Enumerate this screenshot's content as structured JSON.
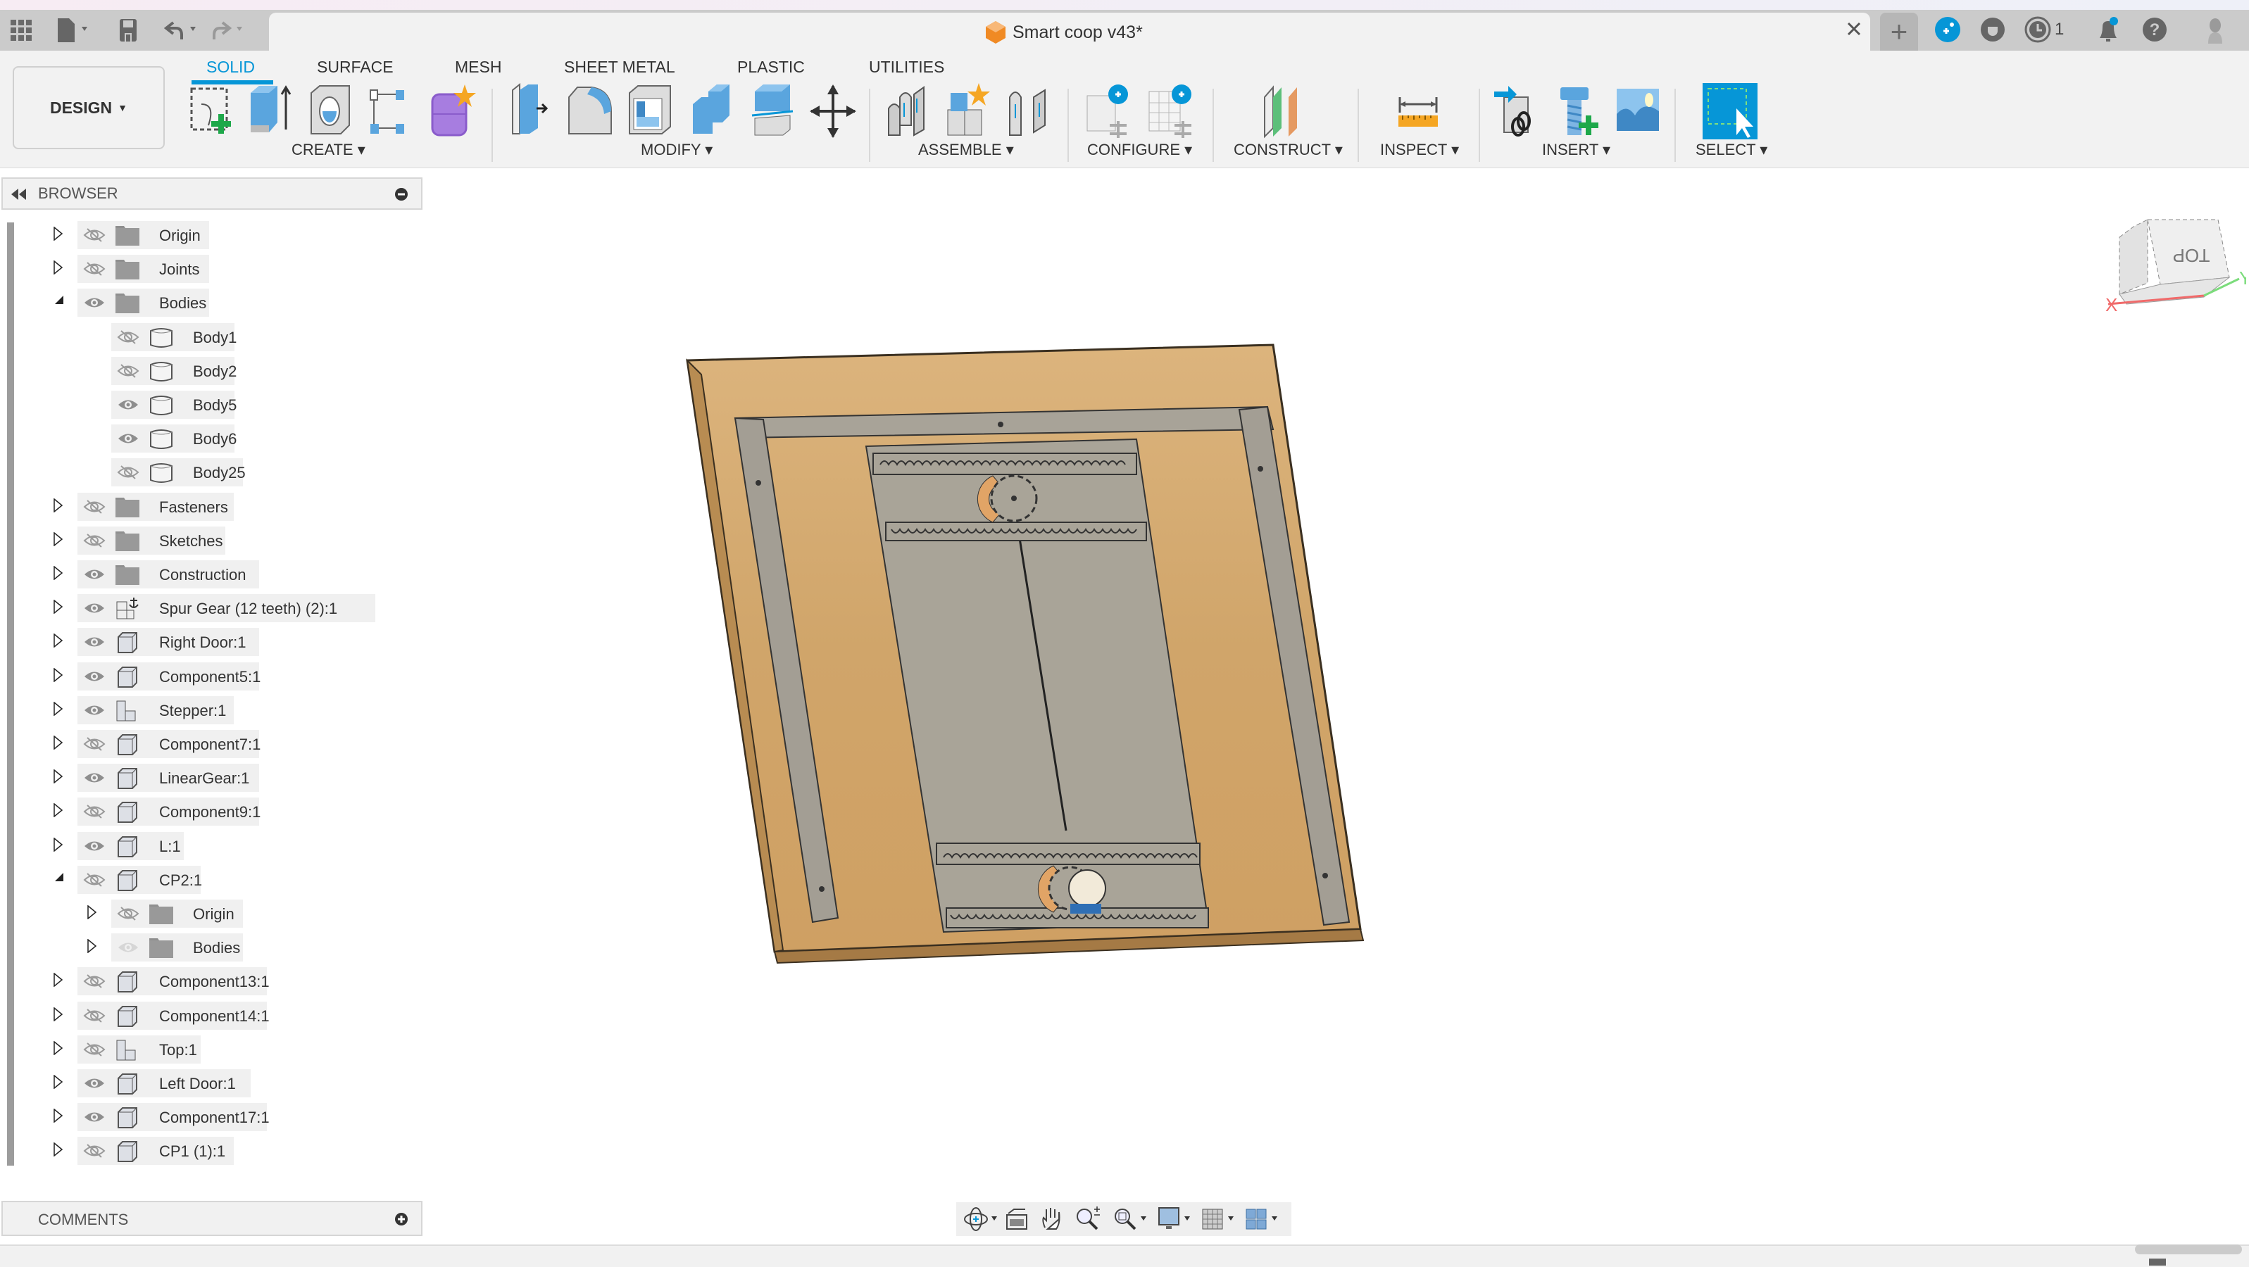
{
  "app": {
    "document_title": "Smart coop v43*",
    "quick_access": {
      "app_menu": "grid-icon",
      "file_menu": "file-icon",
      "save": "save-icon",
      "undo": "undo-icon",
      "redo": "redo-icon"
    },
    "header_right": {
      "new_tab": "+",
      "job_status_count": "1"
    }
  },
  "ribbon": {
    "workspace_button": "DESIGN",
    "tabs": [
      {
        "label": "SOLID",
        "active": true
      },
      {
        "label": "SURFACE",
        "active": false
      },
      {
        "label": "MESH",
        "active": false
      },
      {
        "label": "SHEET METAL",
        "active": false
      },
      {
        "label": "PLASTIC",
        "active": false
      },
      {
        "label": "UTILITIES",
        "active": false
      }
    ],
    "groups": [
      {
        "label": "CREATE",
        "tools": [
          "create-sketch",
          "extrude",
          "revolve",
          "pattern",
          "create-form"
        ]
      },
      {
        "label": "MODIFY",
        "tools": [
          "press-pull",
          "fillet",
          "shell",
          "combine",
          "split-body",
          "move-copy"
        ]
      },
      {
        "label": "ASSEMBLE",
        "tools": [
          "joint",
          "new-component",
          "as-built-joint"
        ]
      },
      {
        "label": "CONFIGURE",
        "tools": [
          "configure-design",
          "configuration-table"
        ]
      },
      {
        "label": "CONSTRUCT",
        "tools": [
          "offset-plane"
        ]
      },
      {
        "label": "INSPECT",
        "tools": [
          "measure"
        ]
      },
      {
        "label": "INSERT",
        "tools": [
          "insert-derive",
          "insert-mcmaster",
          "insert-canvas"
        ]
      },
      {
        "label": "SELECT",
        "tools": [
          "window-select"
        ]
      }
    ]
  },
  "browser": {
    "title": "BROWSER",
    "items": [
      {
        "label": "Origin",
        "level": 0,
        "expanded": false,
        "visible": false,
        "icon": "folder"
      },
      {
        "label": "Joints",
        "level": 0,
        "expanded": false,
        "visible": false,
        "icon": "folder"
      },
      {
        "label": "Bodies",
        "level": 0,
        "expanded": true,
        "visible": true,
        "icon": "folder"
      },
      {
        "label": "Body1",
        "level": 1,
        "leaf": true,
        "visible": false,
        "icon": "body"
      },
      {
        "label": "Body2",
        "level": 1,
        "leaf": true,
        "visible": false,
        "icon": "body"
      },
      {
        "label": "Body5",
        "level": 1,
        "leaf": true,
        "visible": true,
        "icon": "body"
      },
      {
        "label": "Body6",
        "level": 1,
        "leaf": true,
        "visible": true,
        "icon": "body"
      },
      {
        "label": "Body25",
        "level": 1,
        "leaf": true,
        "visible": false,
        "icon": "body"
      },
      {
        "label": "Fasteners",
        "level": 0,
        "expanded": false,
        "visible": false,
        "icon": "folder"
      },
      {
        "label": "Sketches",
        "level": 0,
        "expanded": false,
        "visible": false,
        "icon": "folder"
      },
      {
        "label": "Construction",
        "level": 0,
        "expanded": false,
        "visible": true,
        "icon": "folder"
      },
      {
        "label": "Spur Gear (12 teeth) (2):1",
        "level": 0,
        "expanded": false,
        "visible": true,
        "icon": "anchored-assembly"
      },
      {
        "label": "Right Door:1",
        "level": 0,
        "expanded": false,
        "visible": true,
        "icon": "component"
      },
      {
        "label": "Component5:1",
        "level": 0,
        "expanded": false,
        "visible": true,
        "icon": "component"
      },
      {
        "label": "Stepper:1",
        "level": 0,
        "expanded": false,
        "visible": true,
        "icon": "assembly"
      },
      {
        "label": "Component7:1",
        "level": 0,
        "expanded": false,
        "visible": false,
        "icon": "component"
      },
      {
        "label": "LinearGear:1",
        "level": 0,
        "expanded": false,
        "visible": true,
        "icon": "component"
      },
      {
        "label": "Component9:1",
        "level": 0,
        "expanded": false,
        "visible": false,
        "icon": "component"
      },
      {
        "label": "L:1",
        "level": 0,
        "expanded": false,
        "visible": true,
        "icon": "component"
      },
      {
        "label": "CP2:1",
        "level": 0,
        "expanded": true,
        "visible": false,
        "icon": "component"
      },
      {
        "label": "Origin",
        "level": 1,
        "expanded": false,
        "visible": false,
        "icon": "folder"
      },
      {
        "label": "Bodies",
        "level": 1,
        "expanded": false,
        "visible": "dim",
        "icon": "folder"
      },
      {
        "label": "Component13:1",
        "level": 0,
        "expanded": false,
        "visible": false,
        "icon": "component"
      },
      {
        "label": "Component14:1",
        "level": 0,
        "expanded": false,
        "visible": false,
        "icon": "component"
      },
      {
        "label": "Top:1",
        "level": 0,
        "expanded": false,
        "visible": false,
        "icon": "assembly"
      },
      {
        "label": "Left Door:1",
        "level": 0,
        "expanded": false,
        "visible": true,
        "icon": "component"
      },
      {
        "label": "Component17:1",
        "level": 0,
        "expanded": false,
        "visible": true,
        "icon": "component"
      },
      {
        "label": "CP1 (1):1",
        "level": 0,
        "expanded": false,
        "visible": false,
        "icon": "component"
      }
    ]
  },
  "comments": {
    "title": "COMMENTS"
  },
  "viewcube": {
    "face": "TOP",
    "axis_x": "X",
    "axis_y": "Y"
  },
  "nav_bar": {
    "tools": [
      "orbit",
      "look-at",
      "pan",
      "zoom",
      "fit",
      "display-settings",
      "grid-snaps",
      "viewports"
    ]
  },
  "colors": {
    "accent": "#0696d7",
    "wood": "#d4a96a",
    "frame_gray": "#a8a398",
    "door_gray": "#a9a498"
  }
}
